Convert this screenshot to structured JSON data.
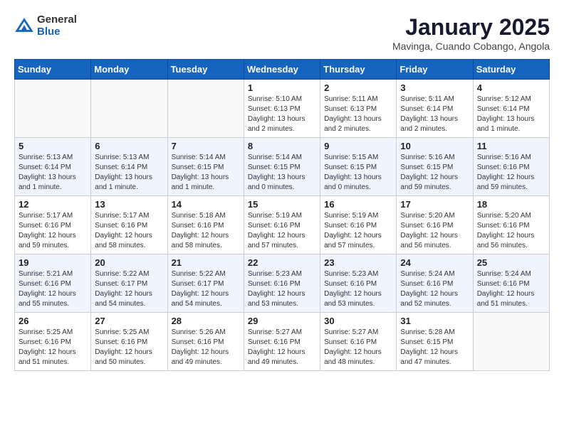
{
  "header": {
    "logo_general": "General",
    "logo_blue": "Blue",
    "month": "January 2025",
    "location": "Mavinga, Cuando Cobango, Angola"
  },
  "weekdays": [
    "Sunday",
    "Monday",
    "Tuesday",
    "Wednesday",
    "Thursday",
    "Friday",
    "Saturday"
  ],
  "weeks": [
    [
      {
        "day": "",
        "info": ""
      },
      {
        "day": "",
        "info": ""
      },
      {
        "day": "",
        "info": ""
      },
      {
        "day": "1",
        "info": "Sunrise: 5:10 AM\nSunset: 6:13 PM\nDaylight: 13 hours\nand 2 minutes."
      },
      {
        "day": "2",
        "info": "Sunrise: 5:11 AM\nSunset: 6:13 PM\nDaylight: 13 hours\nand 2 minutes."
      },
      {
        "day": "3",
        "info": "Sunrise: 5:11 AM\nSunset: 6:14 PM\nDaylight: 13 hours\nand 2 minutes."
      },
      {
        "day": "4",
        "info": "Sunrise: 5:12 AM\nSunset: 6:14 PM\nDaylight: 13 hours\nand 1 minute."
      }
    ],
    [
      {
        "day": "5",
        "info": "Sunrise: 5:13 AM\nSunset: 6:14 PM\nDaylight: 13 hours\nand 1 minute."
      },
      {
        "day": "6",
        "info": "Sunrise: 5:13 AM\nSunset: 6:14 PM\nDaylight: 13 hours\nand 1 minute."
      },
      {
        "day": "7",
        "info": "Sunrise: 5:14 AM\nSunset: 6:15 PM\nDaylight: 13 hours\nand 1 minute."
      },
      {
        "day": "8",
        "info": "Sunrise: 5:14 AM\nSunset: 6:15 PM\nDaylight: 13 hours\nand 0 minutes."
      },
      {
        "day": "9",
        "info": "Sunrise: 5:15 AM\nSunset: 6:15 PM\nDaylight: 13 hours\nand 0 minutes."
      },
      {
        "day": "10",
        "info": "Sunrise: 5:16 AM\nSunset: 6:15 PM\nDaylight: 12 hours\nand 59 minutes."
      },
      {
        "day": "11",
        "info": "Sunrise: 5:16 AM\nSunset: 6:16 PM\nDaylight: 12 hours\nand 59 minutes."
      }
    ],
    [
      {
        "day": "12",
        "info": "Sunrise: 5:17 AM\nSunset: 6:16 PM\nDaylight: 12 hours\nand 59 minutes."
      },
      {
        "day": "13",
        "info": "Sunrise: 5:17 AM\nSunset: 6:16 PM\nDaylight: 12 hours\nand 58 minutes."
      },
      {
        "day": "14",
        "info": "Sunrise: 5:18 AM\nSunset: 6:16 PM\nDaylight: 12 hours\nand 58 minutes."
      },
      {
        "day": "15",
        "info": "Sunrise: 5:19 AM\nSunset: 6:16 PM\nDaylight: 12 hours\nand 57 minutes."
      },
      {
        "day": "16",
        "info": "Sunrise: 5:19 AM\nSunset: 6:16 PM\nDaylight: 12 hours\nand 57 minutes."
      },
      {
        "day": "17",
        "info": "Sunrise: 5:20 AM\nSunset: 6:16 PM\nDaylight: 12 hours\nand 56 minutes."
      },
      {
        "day": "18",
        "info": "Sunrise: 5:20 AM\nSunset: 6:16 PM\nDaylight: 12 hours\nand 56 minutes."
      }
    ],
    [
      {
        "day": "19",
        "info": "Sunrise: 5:21 AM\nSunset: 6:16 PM\nDaylight: 12 hours\nand 55 minutes."
      },
      {
        "day": "20",
        "info": "Sunrise: 5:22 AM\nSunset: 6:17 PM\nDaylight: 12 hours\nand 54 minutes."
      },
      {
        "day": "21",
        "info": "Sunrise: 5:22 AM\nSunset: 6:17 PM\nDaylight: 12 hours\nand 54 minutes."
      },
      {
        "day": "22",
        "info": "Sunrise: 5:23 AM\nSunset: 6:16 PM\nDaylight: 12 hours\nand 53 minutes."
      },
      {
        "day": "23",
        "info": "Sunrise: 5:23 AM\nSunset: 6:16 PM\nDaylight: 12 hours\nand 53 minutes."
      },
      {
        "day": "24",
        "info": "Sunrise: 5:24 AM\nSunset: 6:16 PM\nDaylight: 12 hours\nand 52 minutes."
      },
      {
        "day": "25",
        "info": "Sunrise: 5:24 AM\nSunset: 6:16 PM\nDaylight: 12 hours\nand 51 minutes."
      }
    ],
    [
      {
        "day": "26",
        "info": "Sunrise: 5:25 AM\nSunset: 6:16 PM\nDaylight: 12 hours\nand 51 minutes."
      },
      {
        "day": "27",
        "info": "Sunrise: 5:25 AM\nSunset: 6:16 PM\nDaylight: 12 hours\nand 50 minutes."
      },
      {
        "day": "28",
        "info": "Sunrise: 5:26 AM\nSunset: 6:16 PM\nDaylight: 12 hours\nand 49 minutes."
      },
      {
        "day": "29",
        "info": "Sunrise: 5:27 AM\nSunset: 6:16 PM\nDaylight: 12 hours\nand 49 minutes."
      },
      {
        "day": "30",
        "info": "Sunrise: 5:27 AM\nSunset: 6:16 PM\nDaylight: 12 hours\nand 48 minutes."
      },
      {
        "day": "31",
        "info": "Sunrise: 5:28 AM\nSunset: 6:15 PM\nDaylight: 12 hours\nand 47 minutes."
      },
      {
        "day": "",
        "info": ""
      }
    ]
  ]
}
